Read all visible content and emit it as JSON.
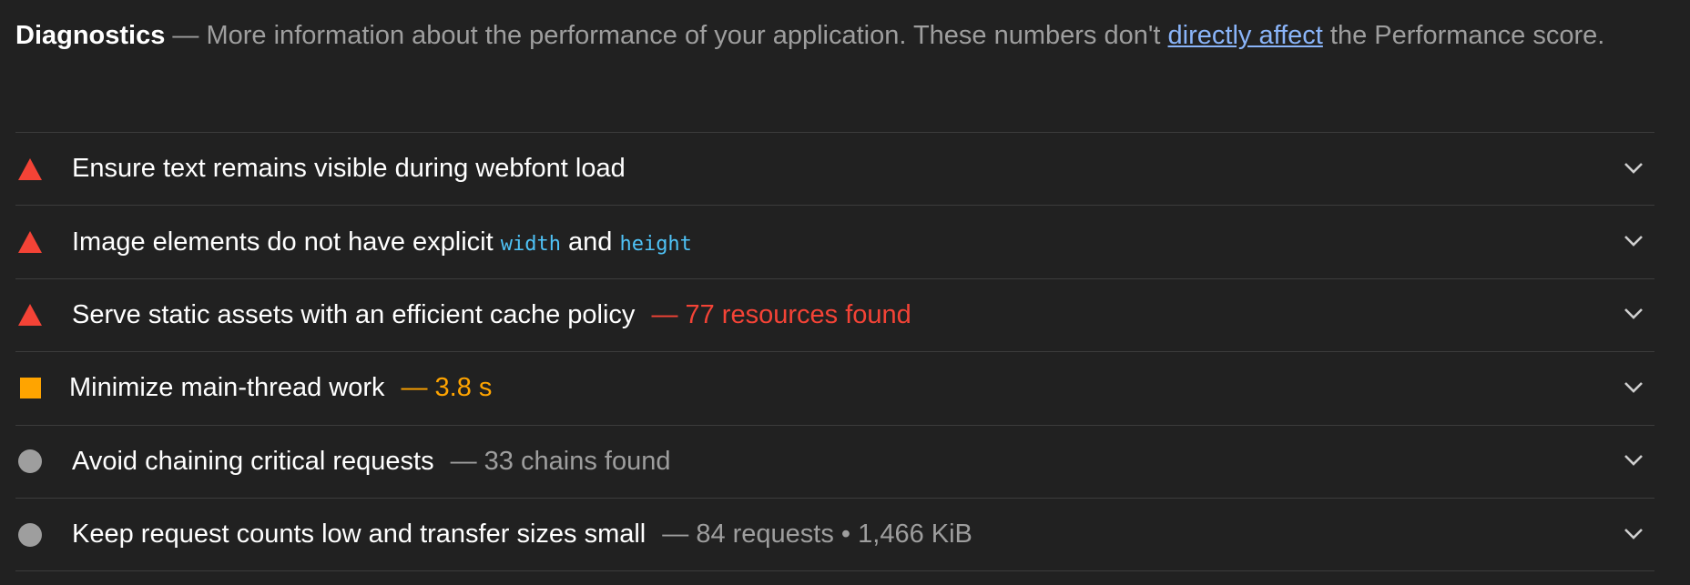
{
  "header": {
    "title": "Diagnostics",
    "description_pre": " — More information about the performance of your application. These numbers don't ",
    "link": "directly affect",
    "description_post": " the Performance score."
  },
  "audits": [
    {
      "severity": "fail",
      "icon": "warning-triangle-icon",
      "label": "Ensure text remains visible during webfont load",
      "display": ""
    },
    {
      "severity": "fail",
      "icon": "warning-triangle-icon",
      "label_parts": [
        "Image elements do not have explicit ",
        "width",
        " and ",
        "height"
      ],
      "display": ""
    },
    {
      "severity": "fail",
      "icon": "warning-triangle-icon",
      "label": "Serve static assets with an efficient cache policy",
      "display": "— 77 resources found"
    },
    {
      "severity": "average",
      "icon": "warning-square-icon",
      "label": "Minimize main-thread work",
      "display": "— 3.8 s"
    },
    {
      "severity": "informative",
      "icon": "info-circle-icon",
      "label": "Avoid chaining critical requests",
      "display": "— 33 chains found"
    },
    {
      "severity": "informative",
      "icon": "info-circle-icon",
      "label": "Keep request counts low and transfer sizes small",
      "display": "— 84 requests • 1,466 KiB"
    }
  ],
  "colors": {
    "background": "#212121",
    "fail": "#f44336",
    "average": "#ffa400",
    "informative": "#9e9e9e",
    "link": "#8ab4f8",
    "code": "#4fc3f7",
    "divider": "#3c3c3c"
  }
}
